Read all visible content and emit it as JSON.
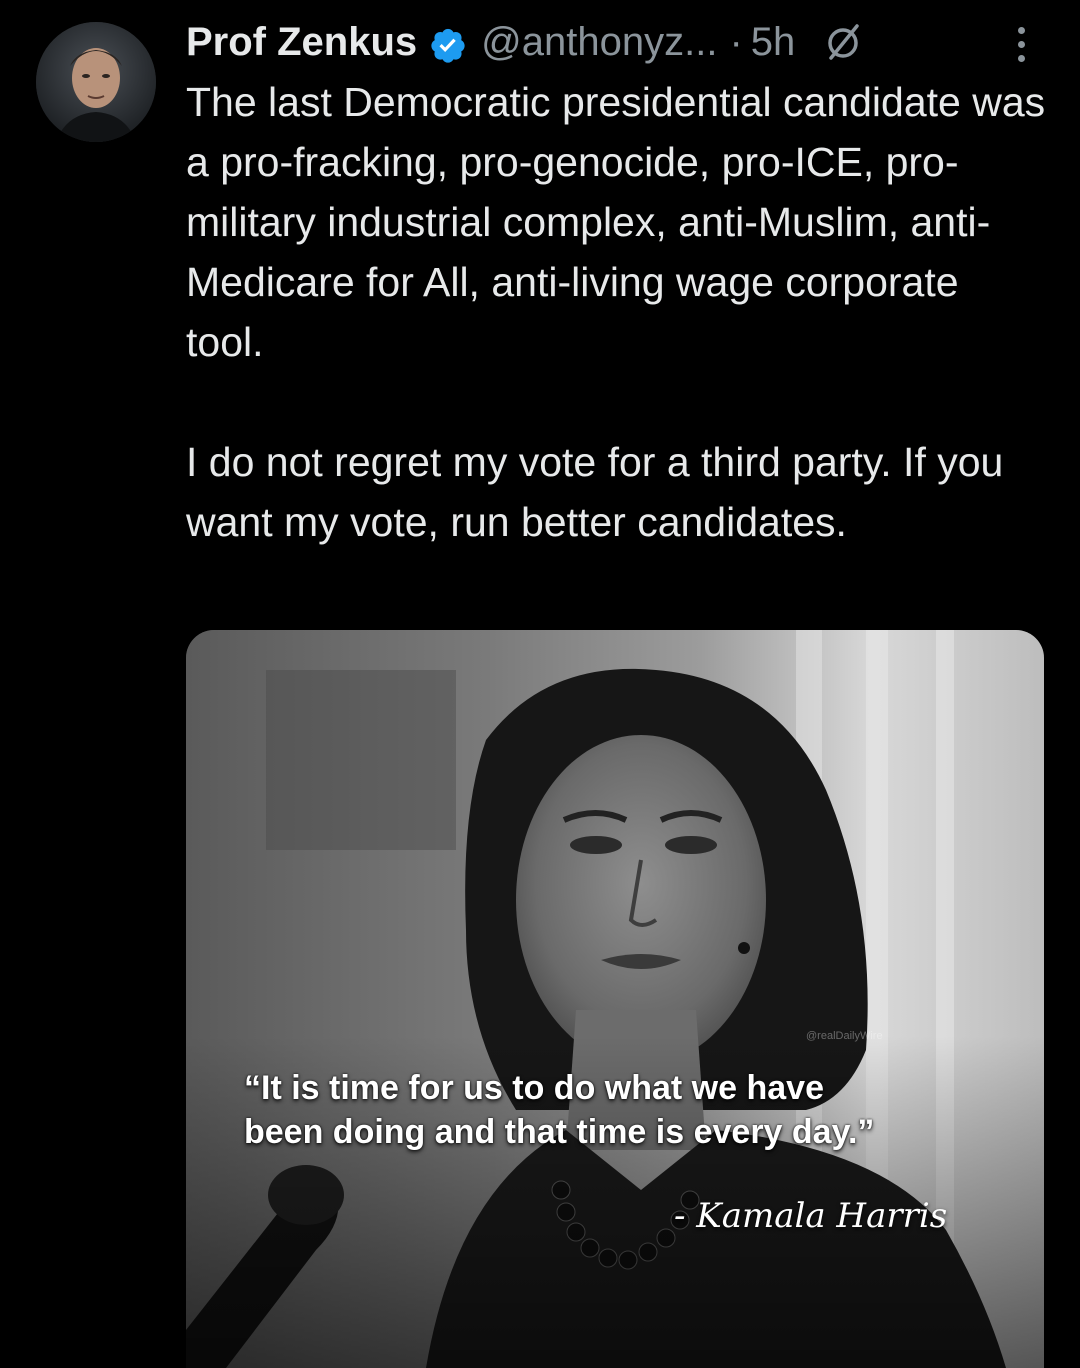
{
  "tweet": {
    "author": {
      "display_name": "Prof Zenkus",
      "handle": "@anthonyz...",
      "separator": "·",
      "time": "5h",
      "verified": true,
      "verified_color": "#1d9bf0"
    },
    "text": {
      "paragraph_1": "The last Democratic presidential candidate was a pro-fracking, pro-genocide, pro-ICE, pro-military industrial complex, anti-Muslim, anti-Medicare for All, anti-living wage corporate tool.",
      "paragraph_2": "I do not regret my vote for a third party. If you want my vote, run better candidates."
    },
    "media": {
      "watermark": "@realDailyWire",
      "quote_line_1": "“It is time for us to do what we have",
      "quote_line_2": "been doing and that time is every day.”",
      "attribution": "- Kamala Harris"
    }
  },
  "icons": {
    "verified": "verified-badge-icon",
    "edited": "edited-icon",
    "more": "more-options-icon"
  },
  "colors": {
    "background": "#000000",
    "text_primary": "#e7e9ea",
    "text_secondary": "#8b949b",
    "accent": "#1d9bf0"
  }
}
